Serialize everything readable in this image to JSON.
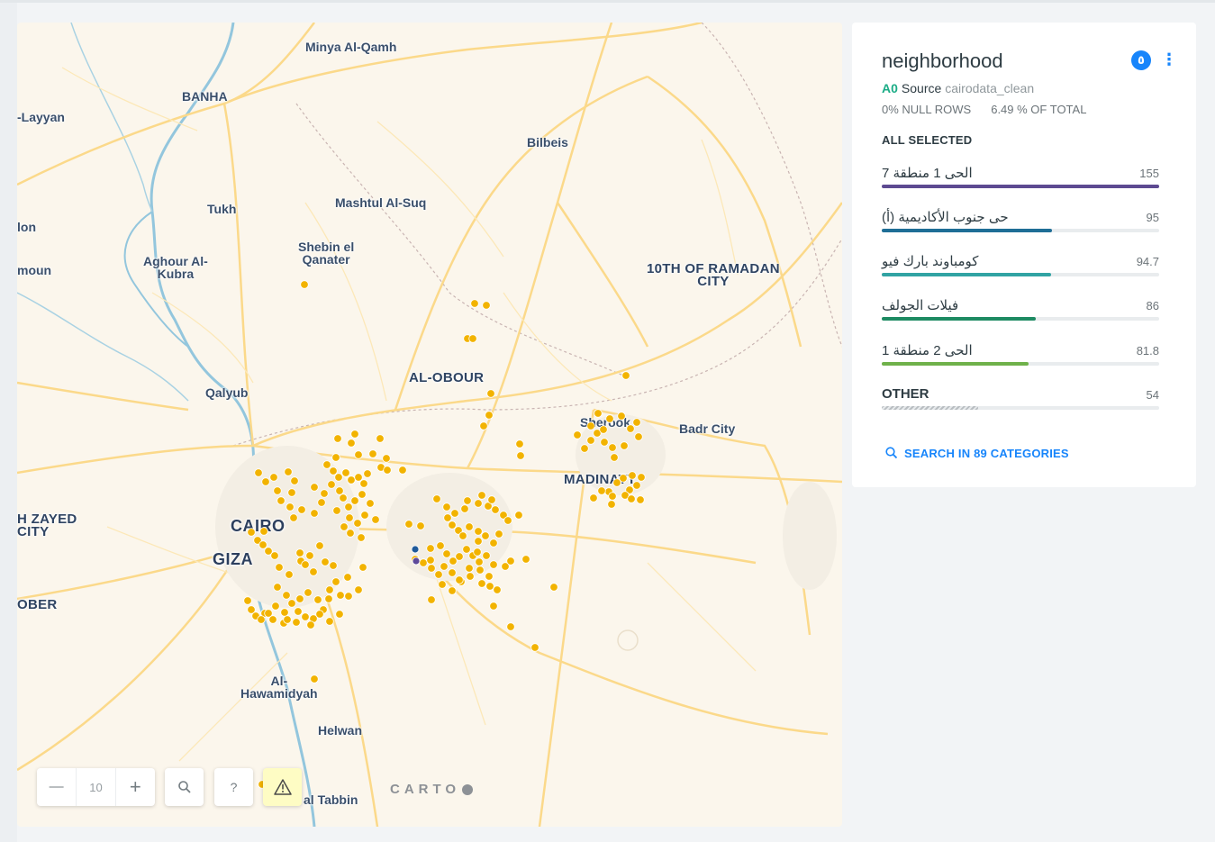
{
  "map": {
    "zoom_level": "10",
    "attribution": "CARTO",
    "colors": {
      "point": "#f2b300",
      "point_outline": "#ffffff",
      "selected_point_a": "#1f5a9a",
      "selected_point_b": "#5e4a9a",
      "road": "#fbd98a",
      "water": "#93c6dd"
    },
    "labels": {
      "minya": "Minya Al-Qamh",
      "banha": "BANHA",
      "layyan": "-Layyan",
      "bilbeis": "Bilbeis",
      "tukh": "Tukh",
      "mashtul": "Mashtul Al-Suq",
      "ion": "lon",
      "shebin": "Shebin el\nQanater",
      "aghour": "Aghour Al-\nKubra",
      "mounl": "moun",
      "tenth": "10TH OF RAMADAN\nCITY",
      "qalyub": "Qalyub",
      "obour": "AL-OBOUR",
      "sherook": "Sherook",
      "badr": "Badr City",
      "madinaty": "MADINATY",
      "zayed": "H ZAYED\nCITY",
      "cairo": "CAIRO",
      "giza": "GIZA",
      "ober": "OBER",
      "hawamidyah": "Al-\nHawamidyah",
      "helwan": "Helwan",
      "tabbin": "al Tabbin"
    }
  },
  "controls": {
    "zoom_out": "—",
    "zoom_in": "+",
    "search_icon": "search-icon",
    "help": "?",
    "warning_icon": "warning-icon"
  },
  "widget": {
    "title": "neighborhood",
    "badge": "٥",
    "more": "⋮",
    "node": "A0",
    "source_label": "Source",
    "source_name": "cairodata_clean",
    "null_rows": "0% NULL ROWS",
    "of_total": "6.49 % OF TOTAL",
    "all_selected": "ALL SELECTED",
    "categories": [
      {
        "name": "الحى 1 منطقة 7",
        "value": "155",
        "fraction": 1.0,
        "color": "#5d4a91"
      },
      {
        "name": "حى جنوب الأكاديمية (أ)",
        "value": "95",
        "fraction": 0.613,
        "color": "#1f6e96"
      },
      {
        "name": "كومباوند بارك فيو",
        "value": "94.7",
        "fraction": 0.611,
        "color": "#31a3a3"
      },
      {
        "name": "فيلات الجولف",
        "value": "86",
        "fraction": 0.555,
        "color": "#1d8a62"
      },
      {
        "name": "الحى 2 منطقة 1",
        "value": "81.8",
        "fraction": 0.528,
        "color": "#6fb14a"
      }
    ],
    "other": {
      "name": "OTHER",
      "value": "54",
      "fraction": 0.348
    },
    "search": "SEARCH IN 89 CATEGORIES"
  }
}
